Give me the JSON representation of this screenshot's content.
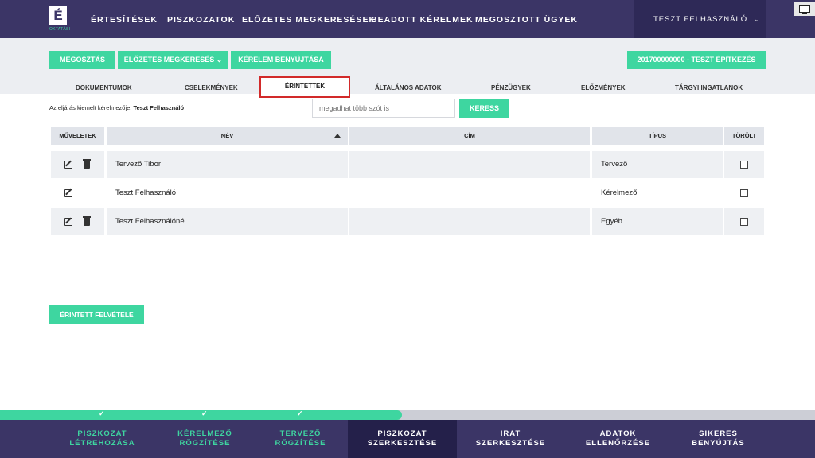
{
  "brand": {
    "letter": "É",
    "sub": "OKTATÁSI"
  },
  "nav": {
    "items": [
      "ÉRTESÍTÉSEK",
      "PISZKOZATOK",
      "ELŐZETES MEGKERESÉSEK",
      "BEADOTT KÉRELMEK",
      "MEGOSZTOTT ÜGYEK"
    ],
    "user": "TESZT FELHASZNÁLÓ",
    "user_chevron": "⌄"
  },
  "actions": {
    "share": "MEGOSZTÁS",
    "inquiry": "ELŐZETES MEGKERESÉS",
    "inquiry_chevron": "⌄",
    "submit": "KÉRELEM BENYÚJTÁSA",
    "case": "201700000000 - TESZT ÉPÍTKEZÉS"
  },
  "tabs": [
    "DOKUMENTUMOK",
    "CSELEKMÉNYEK",
    "ÉRINTETTEK",
    "ÁLTALÁNOS ADATOK",
    "PÉNZÜGYEK",
    "ELŐZMÉNYEK",
    "TÁRGYI INGATLANOK"
  ],
  "active_tab": "ÉRINTETTEK",
  "search": {
    "note_prefix": "Az eljárás kiemelt kérelmezője: ",
    "note_name": "Teszt Felhasználó",
    "placeholder": "megadhat több szót is",
    "button": "KERESS"
  },
  "table": {
    "headers": {
      "actions": "MŰVELETEK",
      "name": "NÉV",
      "address": "CÍM",
      "type": "TÍPUS",
      "deleted": "TÖRÖLT"
    },
    "rows": [
      {
        "name": "Tervező Tibor",
        "address": "",
        "type": "Tervező",
        "deletable": true
      },
      {
        "name": "Teszt Felhasználó",
        "address": "",
        "type": "Kérelmező",
        "deletable": false
      },
      {
        "name": "Teszt Felhasználóné",
        "address": "",
        "type": "Egyéb",
        "deletable": true
      }
    ]
  },
  "add_button": "ÉRINTETT FELVÉTELE",
  "progress": {
    "fraction": 0.493,
    "check": "✓"
  },
  "steps": [
    {
      "l1": "PISZKOZAT",
      "l2": "LÉTREHOZÁSA",
      "state": "done"
    },
    {
      "l1": "KÉRELMEZŐ",
      "l2": "RÖGZÍTÉSE",
      "state": "done"
    },
    {
      "l1": "TERVEZŐ",
      "l2": "RÖGZÍTÉSE",
      "state": "done"
    },
    {
      "l1": "PISZKOZAT",
      "l2": "SZERKESZTÉSE",
      "state": "current"
    },
    {
      "l1": "IRAT",
      "l2": "SZERKESZTÉSE",
      "state": "todo"
    },
    {
      "l1": "ADATOK",
      "l2": "ELLENŐRZÉSE",
      "state": "todo"
    },
    {
      "l1": "SIKERES",
      "l2": "BENYÚJTÁS",
      "state": "todo"
    }
  ],
  "colors": {
    "nav": "#3b3566",
    "accent": "#3ed6a0",
    "highlight": "#d22a2a"
  }
}
